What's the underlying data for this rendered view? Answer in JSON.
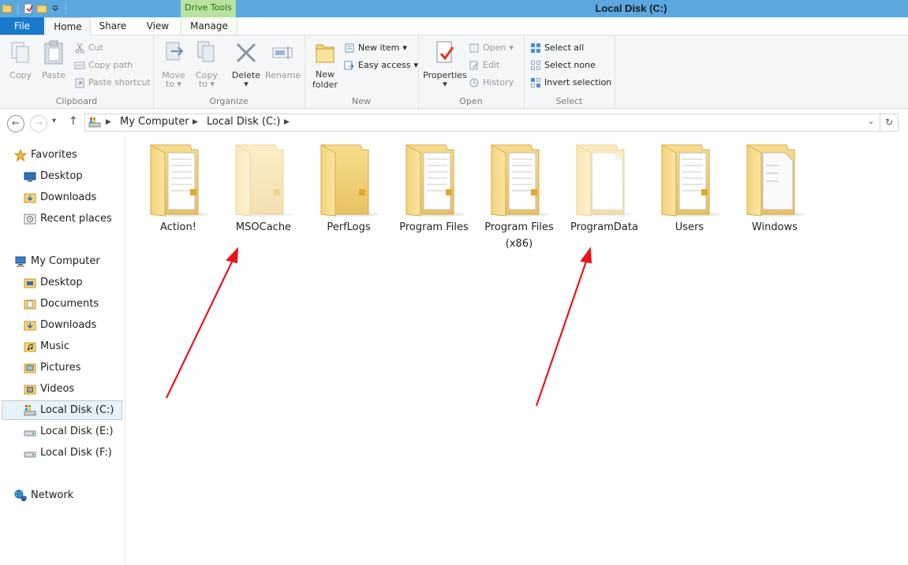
{
  "window": {
    "title": "Local Disk (C:)",
    "context_tab": "Drive Tools"
  },
  "tabs": {
    "file": "File",
    "home": "Home",
    "share": "Share",
    "view": "View",
    "manage": "Manage"
  },
  "ribbon": {
    "clipboard": {
      "label": "Clipboard",
      "copy": "Copy",
      "paste": "Paste",
      "cut": "Cut",
      "copy_path": "Copy path",
      "paste_shortcut": "Paste shortcut"
    },
    "organize": {
      "label": "Organize",
      "move_to_1": "Move",
      "move_to_2": "to",
      "copy_to_1": "Copy",
      "copy_to_2": "to",
      "delete": "Delete",
      "rename": "Rename"
    },
    "new": {
      "label": "New",
      "new_folder_1": "New",
      "new_folder_2": "folder",
      "new_item": "New item",
      "easy_access": "Easy access"
    },
    "open": {
      "label": "Open",
      "properties": "Properties",
      "open": "Open",
      "edit": "Edit",
      "history": "History"
    },
    "select": {
      "label": "Select",
      "select_all": "Select all",
      "select_none": "Select none",
      "invert": "Invert selection"
    }
  },
  "address": {
    "crumbs": [
      "My Computer",
      "Local Disk (C:)"
    ]
  },
  "nav": {
    "favorites": "Favorites",
    "fav_items": [
      "Desktop",
      "Downloads",
      "Recent places"
    ],
    "computer": "My Computer",
    "computer_items": [
      "Desktop",
      "Documents",
      "Downloads",
      "Music",
      "Pictures",
      "Videos",
      "Local Disk (C:)",
      "Local Disk (E:)",
      "Local Disk (F:)"
    ],
    "network": "Network"
  },
  "folders": [
    {
      "name": "Action!",
      "style": "docs"
    },
    {
      "name": "MSOCache",
      "style": "hidden"
    },
    {
      "name": "PerfLogs",
      "style": "empty"
    },
    {
      "name": "Program Files",
      "style": "docs"
    },
    {
      "name": "Program Files (x86)",
      "style": "docs"
    },
    {
      "name": "ProgramData",
      "style": "hidden-docs"
    },
    {
      "name": "Users",
      "style": "docs"
    },
    {
      "name": "Windows",
      "style": "white-docs"
    }
  ],
  "colors": {
    "accent": "#1979ca",
    "titlebar": "#5ba8e0",
    "context": "#b7e3a0",
    "arrow": "#e8151b"
  }
}
